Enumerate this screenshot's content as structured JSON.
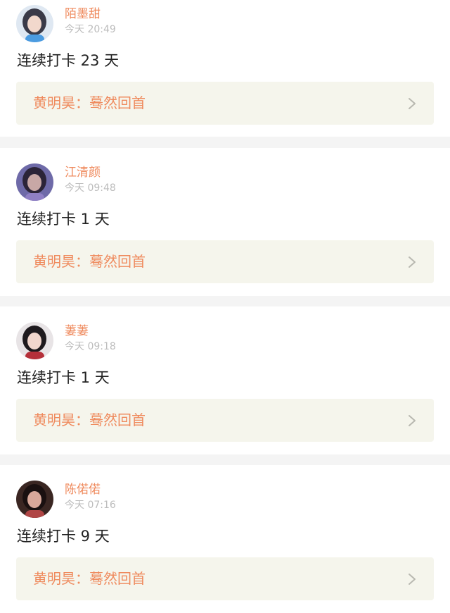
{
  "posts": [
    {
      "username": "陌墨甜",
      "time": "今天 20:49",
      "text": "连续打卡 23 天",
      "link": "黄明昊：蓦然回首",
      "avatar_icon": "avatar-photo",
      "avatar_colors": [
        "#dfe8f2",
        "#3a3a48",
        "#f2d8cc",
        "#4b9be0"
      ]
    },
    {
      "username": "江清颜",
      "time": "今天 09:48",
      "text": "连续打卡 1 天",
      "link": "黄明昊：蓦然回首",
      "avatar_icon": "avatar-photo",
      "avatar_colors": [
        "#6e6aa8",
        "#2b2438",
        "#c8a8a6",
        "#8f7fc4"
      ]
    },
    {
      "username": "萋萋",
      "time": "今天 09:18",
      "text": "连续打卡 1 天",
      "link": "黄明昊：蓦然回首",
      "avatar_icon": "avatar-photo",
      "avatar_colors": [
        "#e8e4e6",
        "#1e1a1e",
        "#f1d6cd",
        "#b5303a"
      ]
    },
    {
      "username": "陈偌偌",
      "time": "今天 07:16",
      "text": "连续打卡 9 天",
      "link": "黄明昊：蓦然回首",
      "avatar_icon": "avatar-photo",
      "avatar_colors": [
        "#3a2622",
        "#1a1010",
        "#d9a89a",
        "#b04545"
      ]
    }
  ],
  "colors": {
    "accent": "#ef8a5d",
    "timestamp": "#bcbcbc",
    "link_background": "#f5f5ec",
    "separator": "#f4f4f4"
  }
}
